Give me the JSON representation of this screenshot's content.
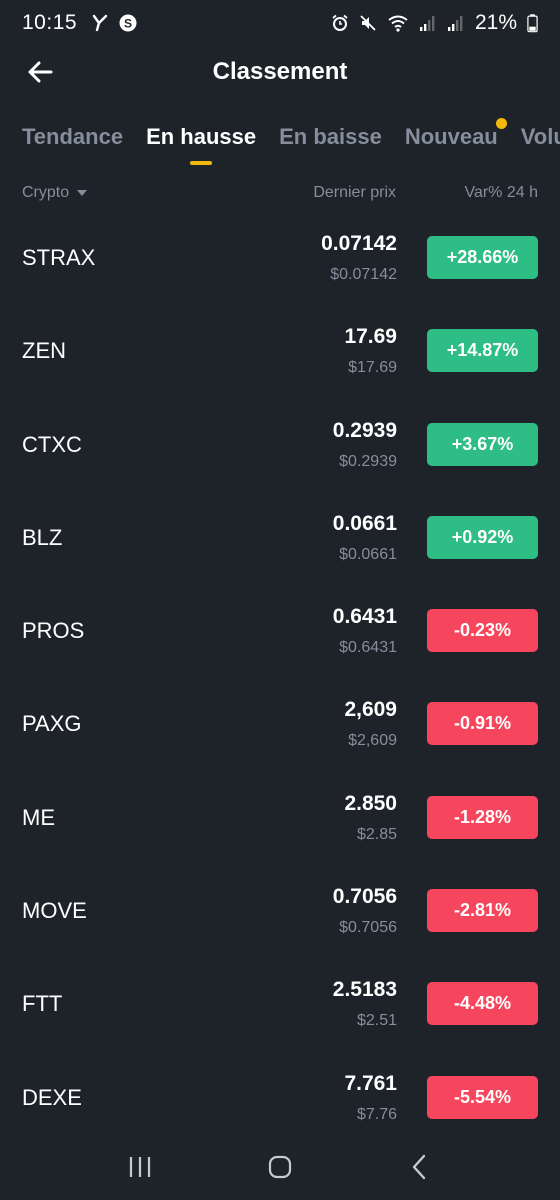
{
  "status_bar": {
    "time": "10:15",
    "battery_percent": "21%",
    "icons": [
      "y-icon",
      "s-circle-icon",
      "alarm-icon",
      "mute-icon",
      "wifi-icon",
      "signal-icon",
      "signal-icon-2",
      "battery-icon"
    ]
  },
  "header": {
    "title": "Classement",
    "back_icon": "arrow-left-icon"
  },
  "tabs": [
    {
      "label": "Tendance",
      "active": false
    },
    {
      "label": "En hausse",
      "active": true
    },
    {
      "label": "En baisse",
      "active": false
    },
    {
      "label": "Nouveau",
      "active": false,
      "has_dot": true
    },
    {
      "label": "Volume",
      "active": false
    }
  ],
  "columns": {
    "crypto": "Crypto",
    "price": "Dernier prix",
    "change": "Var% 24 h"
  },
  "rows": [
    {
      "symbol": "STRAX",
      "price": "0.07142",
      "usd": "$0.07142",
      "change": "+28.66%",
      "direction": "up"
    },
    {
      "symbol": "ZEN",
      "price": "17.69",
      "usd": "$17.69",
      "change": "+14.87%",
      "direction": "up"
    },
    {
      "symbol": "CTXC",
      "price": "0.2939",
      "usd": "$0.2939",
      "change": "+3.67%",
      "direction": "up"
    },
    {
      "symbol": "BLZ",
      "price": "0.0661",
      "usd": "$0.0661",
      "change": "+0.92%",
      "direction": "up"
    },
    {
      "symbol": "PROS",
      "price": "0.6431",
      "usd": "$0.6431",
      "change": "-0.23%",
      "direction": "down"
    },
    {
      "symbol": "PAXG",
      "price": "2,609",
      "usd": "$2,609",
      "change": "-0.91%",
      "direction": "down"
    },
    {
      "symbol": "ME",
      "price": "2.850",
      "usd": "$2.85",
      "change": "-1.28%",
      "direction": "down"
    },
    {
      "symbol": "MOVE",
      "price": "0.7056",
      "usd": "$0.7056",
      "change": "-2.81%",
      "direction": "down"
    },
    {
      "symbol": "FTT",
      "price": "2.5183",
      "usd": "$2.51",
      "change": "-4.48%",
      "direction": "down"
    },
    {
      "symbol": "DEXE",
      "price": "7.761",
      "usd": "$7.76",
      "change": "-5.54%",
      "direction": "down"
    }
  ],
  "colors": {
    "background": "#1e2329",
    "accent": "#f0b90b",
    "up": "#2ebd85",
    "down": "#f6465d",
    "muted": "#848e9c"
  },
  "navbar": {
    "icons": [
      "recent-apps-icon",
      "home-icon",
      "back-nav-icon"
    ]
  }
}
